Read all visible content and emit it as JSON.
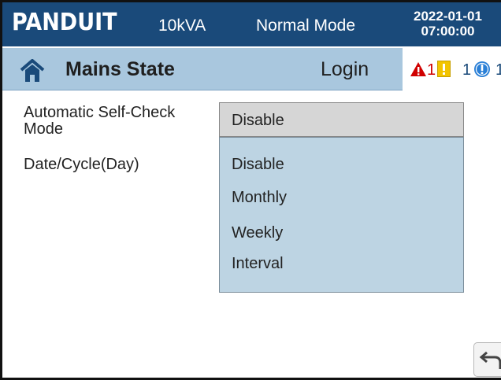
{
  "header": {
    "logo": "PANDUIT",
    "rating": "10kVA",
    "mode": "Normal Mode",
    "date": "2022-01-01",
    "time": "07:00:00"
  },
  "subbar": {
    "title": "Mains State",
    "login": "Login",
    "alarms": {
      "critical_count": "1",
      "warning_count": "1",
      "info_count": "1"
    }
  },
  "settings": {
    "self_check_label": "Automatic Self-Check Mode",
    "date_cycle_label": "Date/Cycle(Day)",
    "selected_value": "Disable",
    "options": [
      "Disable",
      "Monthly",
      "Weekly",
      "Interval"
    ]
  },
  "icons": {
    "home": "home-icon",
    "critical": "warning-triangle-icon",
    "warning": "exclamation-square-icon",
    "info": "info-circle-icon",
    "back": "back-arrow-icon"
  },
  "colors": {
    "header_bg": "#1a4a7a",
    "subbar_bg": "#a9c7de",
    "dropdown_bg": "#bdd4e3",
    "critical": "#d00000",
    "warning": "#f2c400",
    "info": "#2a7fd6"
  }
}
